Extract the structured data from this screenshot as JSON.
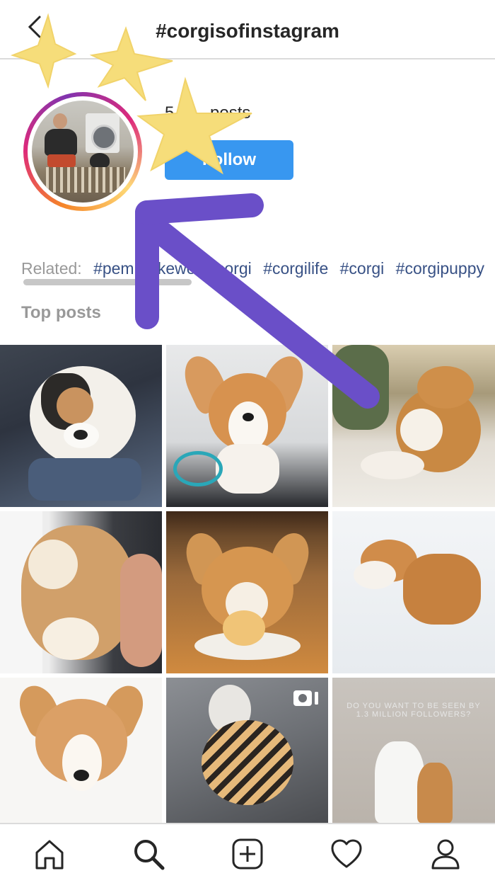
{
  "header": {
    "title": "#corgisofinstagram",
    "back_icon": "back-arrow-icon"
  },
  "profile": {
    "posts_count": "5.0… posts",
    "follow_label": "Follow"
  },
  "related": {
    "label": "Related:",
    "tags": [
      "#pembrokewelshcorgi",
      "#corgilife",
      "#corgi",
      "#corgipuppy"
    ]
  },
  "section_title": "Top posts",
  "posts": [
    {
      "description": "black-white-tan corgi puppy lying on blue jeans"
    },
    {
      "description": "tan corgi puppy sitting on office chair with blue leash"
    },
    {
      "description": "corgi lying on back on sofa outside"
    },
    {
      "description": "fluffy corgi puppy asleep on person's lap"
    },
    {
      "description": "corgi staring at plate with food"
    },
    {
      "description": "corgi rolling in snow"
    },
    {
      "description": "corgi puppy face close-up"
    },
    {
      "description": "corgi in tiger costume howling",
      "badge_icon": "igtv-icon"
    },
    {
      "description": "white dog and corgi sitting together",
      "overlay_text": "DO YOU WANT TO BE SEEN BY 1.3 MILLION FOLLOWERS?"
    }
  ],
  "nav": [
    "home-icon",
    "search-icon",
    "new-post-icon",
    "activity-heart-icon",
    "profile-icon"
  ],
  "annotations": {
    "stars": 3,
    "arrow_color": "#6a4fc8",
    "star_color": "#f6dd7a"
  }
}
